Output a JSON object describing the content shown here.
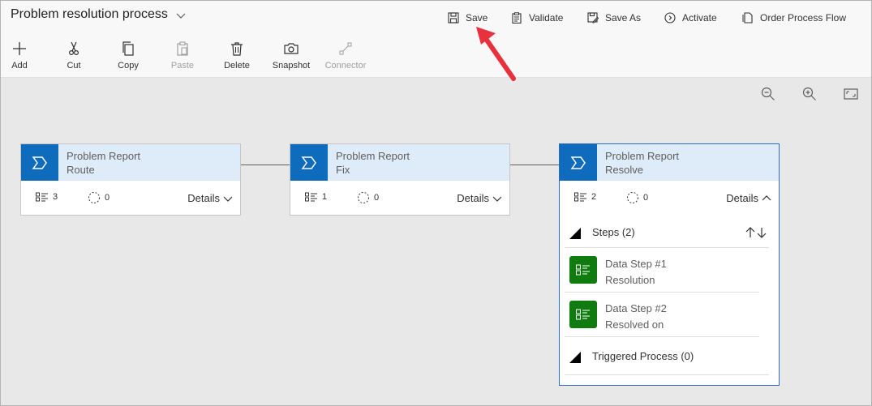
{
  "header": {
    "title": "Problem resolution process",
    "commands": [
      {
        "label": "Save",
        "icon": "save-icon"
      },
      {
        "label": "Validate",
        "icon": "clipboard-check-icon"
      },
      {
        "label": "Save As",
        "icon": "save-as-icon"
      },
      {
        "label": "Activate",
        "icon": "activate-icon"
      },
      {
        "label": "Order Process Flow",
        "icon": "order-icon"
      }
    ]
  },
  "toolbar": {
    "add": "Add",
    "cut": "Cut",
    "copy": "Copy",
    "paste": "Paste",
    "delete": "Delete",
    "snapshot": "Snapshot",
    "connector": "Connector"
  },
  "stages": [
    {
      "entity": "Problem Report",
      "name": "Route",
      "steps": "3",
      "triggers": "0",
      "details": "Details"
    },
    {
      "entity": "Problem Report",
      "name": "Fix",
      "steps": "1",
      "triggers": "0",
      "details": "Details"
    },
    {
      "entity": "Problem Report",
      "name": "Resolve",
      "steps": "2",
      "triggers": "0",
      "details": "Details",
      "steps_section": "Steps (2)",
      "data_steps": [
        {
          "title": "Data Step #1",
          "field": "Resolution"
        },
        {
          "title": "Data Step #2",
          "field": "Resolved on"
        }
      ],
      "triggered_section": "Triggered Process (0)"
    }
  ],
  "colors": {
    "accent": "#0f6cbd",
    "stage_header": "#deecf9",
    "data_step": "#107c10",
    "annotation_arrow": "#e8313c"
  }
}
